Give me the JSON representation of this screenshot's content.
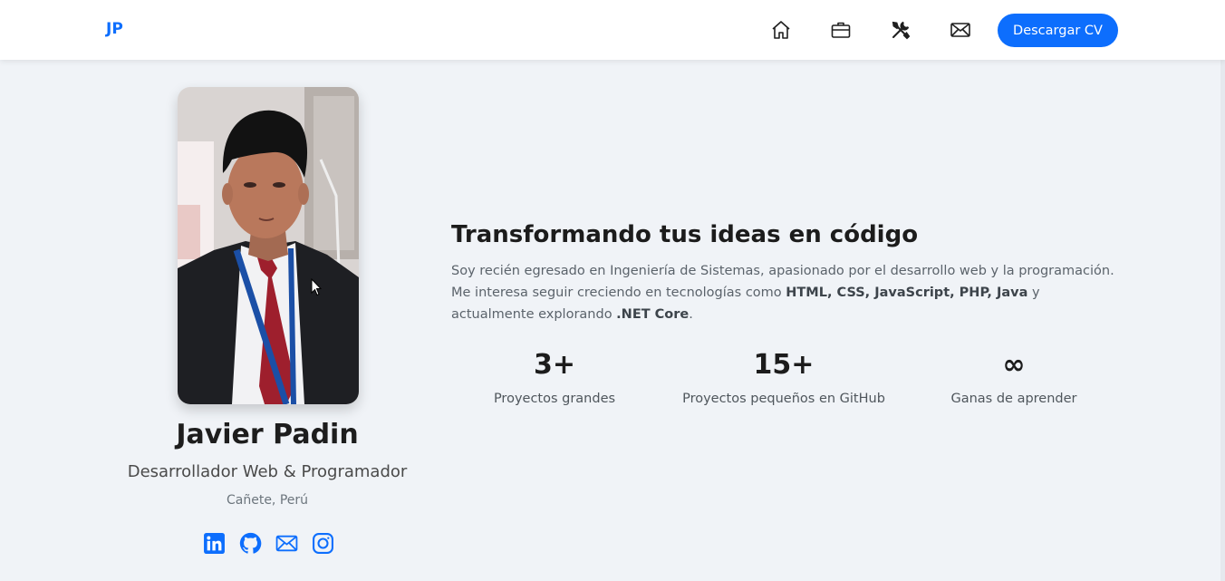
{
  "nav": {
    "brand": "JP",
    "icons": [
      "house-icon",
      "briefcase-icon",
      "tools-icon",
      "envelope-icon"
    ],
    "cv_button": "Descargar CV"
  },
  "profile": {
    "name": "Javier Padin",
    "role": "Desarrollador Web & Programador",
    "location": "Cañete, Perú",
    "social_icons": [
      "linkedin-icon",
      "github-icon",
      "envelope-icon",
      "instagram-icon"
    ]
  },
  "about": {
    "headline": "Transformando tus ideas en código",
    "bio_parts": [
      "Soy recién egresado en Ingeniería de Sistemas, apasionado por el desarrollo web y la programación. Me interesa seguir creciendo en tecnologías como ",
      "HTML, CSS, JavaScript, PHP, Java",
      " y actualmente explorando ",
      ".NET Core",
      "."
    ]
  },
  "stats": [
    {
      "value": "3+",
      "label": "Proyectos grandes"
    },
    {
      "value": "15+",
      "label": "Proyectos pequeños en GitHub"
    },
    {
      "value": "∞",
      "label": "Ganas de aprender"
    }
  ],
  "colors": {
    "accent": "#0d6efd",
    "background": "#f0f3f7",
    "navbar": "#ffffff"
  }
}
